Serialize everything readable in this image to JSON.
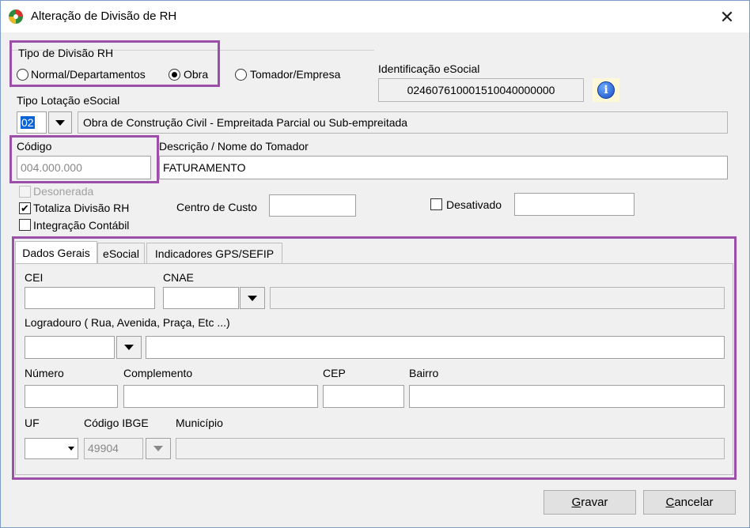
{
  "window": {
    "title": "Alteração de Divisão de RH",
    "close_glyph": "✕"
  },
  "tipo_divisao": {
    "legend": "Tipo de Divisão RH",
    "options": [
      {
        "label": "Normal/Departamentos",
        "selected": false
      },
      {
        "label": "Obra",
        "selected": true
      },
      {
        "label": "Tomador/Empresa",
        "selected": false
      }
    ]
  },
  "esocial_id": {
    "label": "Identificação eSocial",
    "value": "024607610001510040000000",
    "icon": "info-icon"
  },
  "tipo_lotacao": {
    "label": "Tipo Lotação eSocial",
    "code": "02",
    "description": "Obra de Construção Civil - Empreitada Parcial ou Sub-empreitada"
  },
  "codigo": {
    "label": "Código",
    "value": "004.000.000"
  },
  "descricao": {
    "label": "Descrição / Nome do Tomador",
    "value": "FATURAMENTO"
  },
  "checks": {
    "desonerada": {
      "label": "Desonerada",
      "checked": false,
      "disabled": true
    },
    "totaliza": {
      "label": "Totaliza Divisão RH",
      "checked": true,
      "mark": "✔"
    },
    "integracao": {
      "label": "Integração Contábil",
      "checked": false
    },
    "desativado": {
      "label": "Desativado",
      "checked": false
    }
  },
  "centro_custo": {
    "label": "Centro de Custo",
    "value": ""
  },
  "desativado_field": {
    "value": ""
  },
  "tabs": [
    {
      "label": "Dados Gerais",
      "active": true
    },
    {
      "label": "eSocial",
      "active": false
    },
    {
      "label": "Indicadores GPS/SEFIP",
      "active": false
    }
  ],
  "dados_gerais": {
    "cei": {
      "label": "CEI",
      "value": ""
    },
    "cnae": {
      "label": "CNAE",
      "value": "",
      "description": ""
    },
    "logradouro": {
      "label": "Logradouro ( Rua, Avenida, Praça, Etc ...)",
      "type": "",
      "value": ""
    },
    "numero": {
      "label": "Número",
      "value": ""
    },
    "complemento": {
      "label": "Complemento",
      "value": ""
    },
    "cep": {
      "label": "CEP",
      "value": ""
    },
    "bairro": {
      "label": "Bairro",
      "value": ""
    },
    "uf": {
      "label": "UF",
      "value": ""
    },
    "codigo_ibge": {
      "label": "Código IBGE",
      "value": "49904"
    },
    "municipio": {
      "label": "Município",
      "value": ""
    }
  },
  "buttons": {
    "gravar": {
      "prefix": "",
      "accel": "G",
      "rest": "ravar"
    },
    "cancelar": {
      "prefix": "",
      "accel": "C",
      "rest": "ancelar"
    }
  },
  "colors": {
    "highlight": "#9b4fa8",
    "selection": "#0a64d8"
  }
}
